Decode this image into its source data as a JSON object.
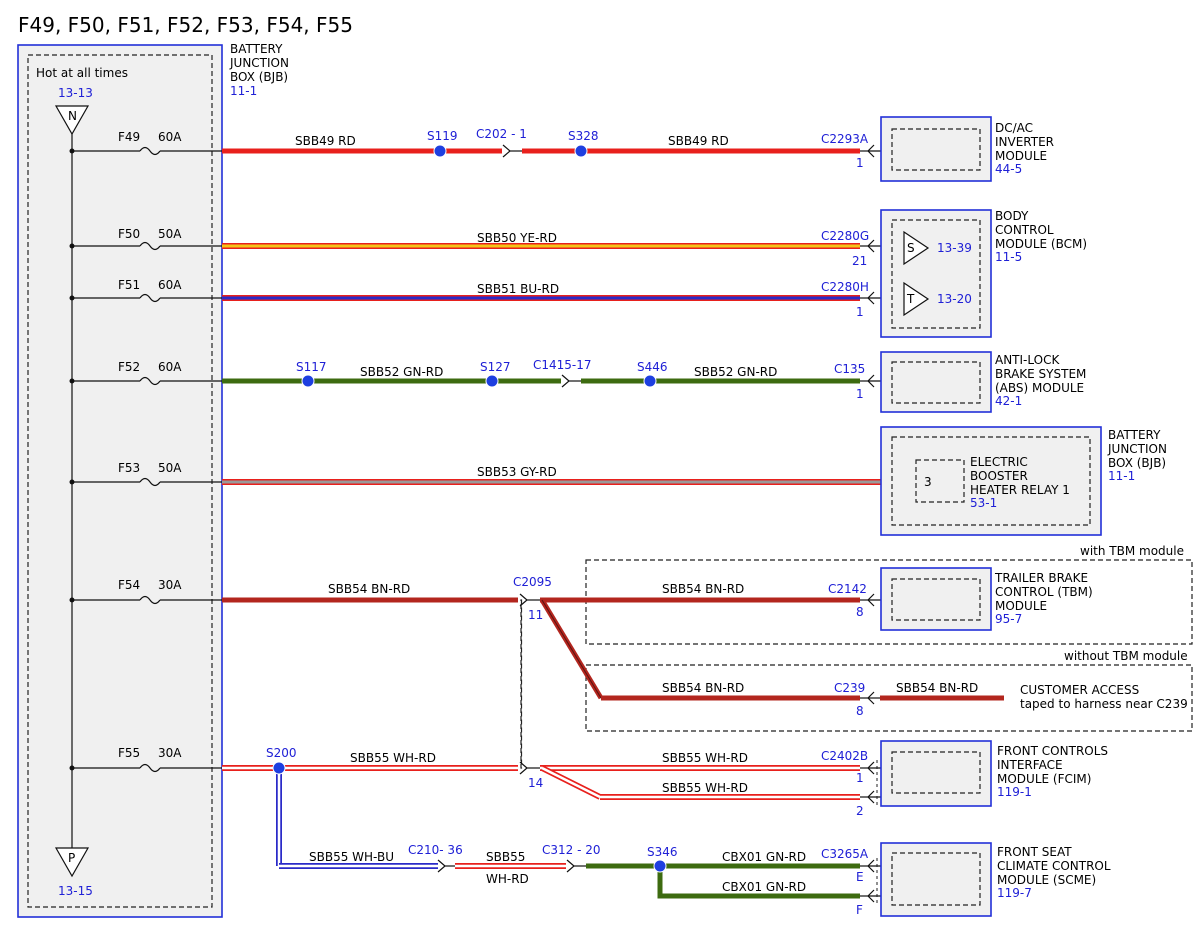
{
  "title": "F49, F50, F51, F52, F53, F54, F55",
  "bjb": {
    "label_lines": [
      "BATTERY",
      "JUNCTION",
      "BOX (BJB)"
    ],
    "ref": "11-1",
    "hot_label": "Hot at all times",
    "top_ref": "13-13",
    "top_node": "N",
    "bottom_ref": "13-15",
    "bottom_node": "P"
  },
  "fuses": [
    {
      "id": "F49",
      "rating": "60A"
    },
    {
      "id": "F50",
      "rating": "50A"
    },
    {
      "id": "F51",
      "rating": "60A"
    },
    {
      "id": "F52",
      "rating": "60A"
    },
    {
      "id": "F53",
      "rating": "50A"
    },
    {
      "id": "F54",
      "rating": "30A"
    },
    {
      "id": "F55",
      "rating": "30A"
    }
  ],
  "wire_labels": {
    "f49_a": "SBB49  RD",
    "f49_b": "SBB49  RD",
    "f50": "SBB50  YE-RD",
    "f51": "SBB51  BU-RD",
    "f52_a": "SBB52  GN-RD",
    "f52_b": "SBB52  GN-RD",
    "f53": "SBB53  GY-RD",
    "f54_a": "SBB54  BN-RD",
    "f54_b": "SBB54  BN-RD",
    "f54_c": "SBB54  BN-RD",
    "f54_d": "SBB54  BN-RD",
    "f55_a": "SBB55  WH-RD",
    "f55_b": "SBB55  WH-RD",
    "f55_c": "SBB55  WH-RD",
    "f55_bu": "SBB55  WH-BU",
    "f55_mid_1": "SBB55",
    "f55_mid_2": "WH-RD",
    "cbx_a": "CBX01  GN-RD",
    "cbx_b": "CBX01  GN-RD"
  },
  "splices": {
    "s119": "S119",
    "s328": "S328",
    "s117": "S117",
    "s127": "S127",
    "s446": "S446",
    "s200": "S200",
    "s346": "S346"
  },
  "connectors": {
    "c202": "C202 - 1",
    "c2293a": "C2293A",
    "c2293a_pin": "1",
    "c2280g": "C2280G",
    "c2280g_pin": "21",
    "c2280h": "C2280H",
    "c2280h_pin": "1",
    "c1415": "C1415-17",
    "c135": "C135",
    "c135_pin": "1",
    "c2095": "C2095",
    "c2095_pin_a": "11",
    "c2095_pin_b": "14",
    "c2142": "C2142",
    "c2142_pin": "8",
    "c239": "C239",
    "c239_pin": "8",
    "c2402b": "C2402B",
    "c2402b_pin_a": "1",
    "c2402b_pin_b": "2",
    "c210": "C210- 36",
    "c312": "C312 - 20",
    "c3265a": "C3265A",
    "c3265a_pin_a": "E",
    "c3265a_pin_b": "F"
  },
  "modules": {
    "dcac": {
      "lines": [
        "DC/AC",
        "INVERTER",
        "MODULE"
      ],
      "ref": "44-5"
    },
    "bcm": {
      "lines": [
        "BODY",
        "CONTROL",
        "MODULE (BCM)"
      ],
      "ref": "11-5",
      "s_label": "S",
      "s_ref": "13-39",
      "t_label": "T",
      "t_ref": "13-20"
    },
    "abs": {
      "lines": [
        "ANTI-LOCK",
        "BRAKE SYSTEM",
        "(ABS) MODULE"
      ],
      "ref": "42-1"
    },
    "bjb2": {
      "lines": [
        "BATTERY",
        "JUNCTION",
        "BOX (BJB)"
      ],
      "ref": "11-1",
      "relay_pin": "3",
      "relay_lines": [
        "ELECTRIC",
        "BOOSTER",
        "HEATER RELAY 1"
      ],
      "relay_ref": "53-1"
    },
    "tbm": {
      "lines": [
        "TRAILER BRAKE",
        "CONTROL (TBM)",
        "MODULE"
      ],
      "ref": "95-7"
    },
    "fcim": {
      "lines": [
        "FRONT CONTROLS",
        "INTERFACE",
        "MODULE (FCIM)"
      ],
      "ref": "119-1"
    },
    "scme": {
      "lines": [
        "FRONT SEAT",
        "CLIMATE CONTROL",
        "MODULE (SCME)"
      ],
      "ref": "119-7"
    }
  },
  "options": {
    "with_tbm": "with TBM module",
    "without_tbm": "without TBM module",
    "customer_1": "CUSTOMER ACCESS",
    "customer_2": "taped to harness near C239"
  },
  "colors": {
    "rd": "#e8201c",
    "ye": "#f5c416",
    "bu": "#2a2ac8",
    "gn": "#3d6b10",
    "gy": "#9a9a9a",
    "bn": "#b3261e",
    "wh": "#ffffff",
    "splice": "#1e3fe0",
    "link": "#1f20d6"
  }
}
